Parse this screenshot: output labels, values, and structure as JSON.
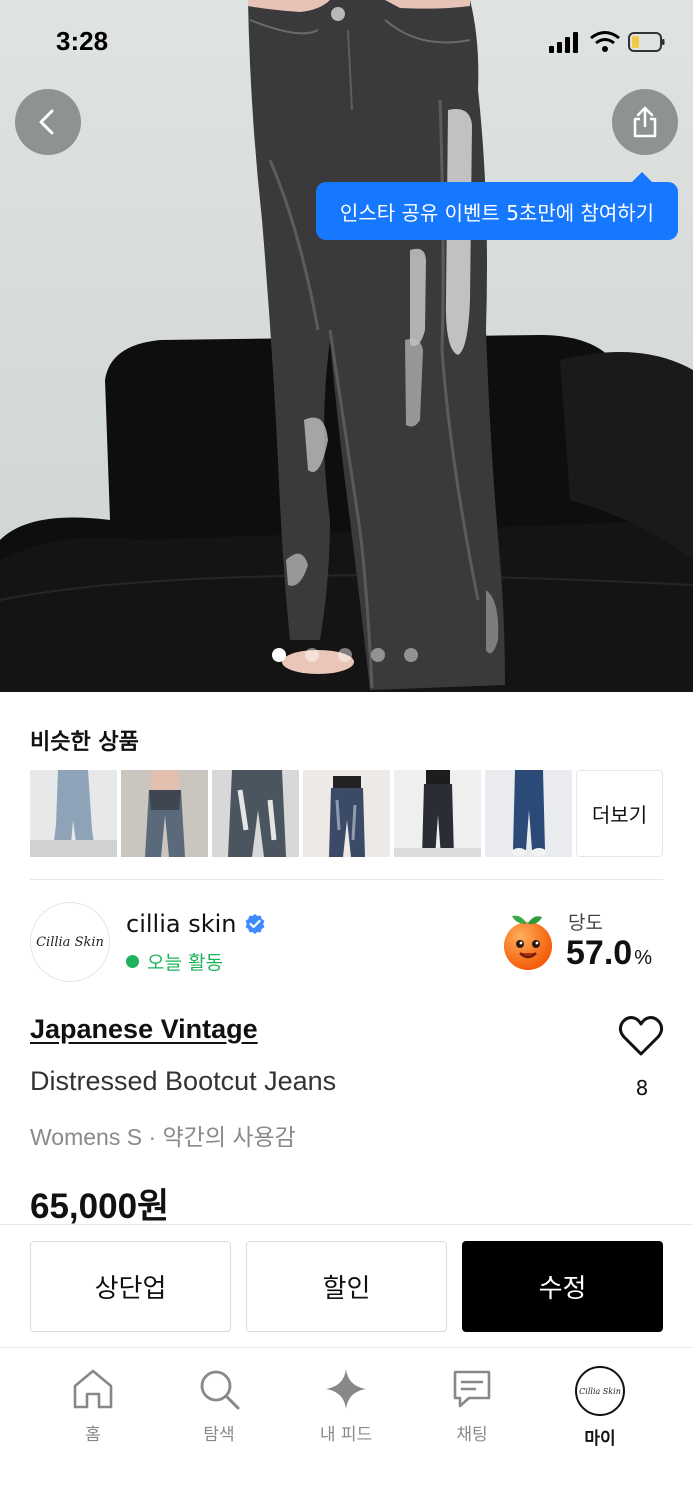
{
  "status_bar": {
    "time": "3:28"
  },
  "hero": {
    "tooltip": "인스타 공유 이벤트 5초만에 참여하기",
    "image_count": 5,
    "active_index": 0
  },
  "similar": {
    "title": "비슷한 상품",
    "thumbnails": [
      "thumb-1",
      "thumb-2",
      "thumb-3",
      "thumb-4",
      "thumb-5",
      "thumb-6"
    ],
    "more_label": "더보기"
  },
  "seller": {
    "avatar_text": "Cillia Skin",
    "name": "cillia skin",
    "status": "오늘 활동",
    "sweetness_label": "당도",
    "sweetness_value": "57.0",
    "sweetness_unit": "%"
  },
  "product": {
    "brand": "Japanese Vintage",
    "name": "Distressed Bootcut Jeans",
    "meta": "Womens S · 약간의 사용감",
    "price": "65,000원",
    "like_count": "8"
  },
  "actions": {
    "bump": "상단업",
    "discount": "할인",
    "edit": "수정"
  },
  "tabs": [
    {
      "label": "홈",
      "icon": "home-icon"
    },
    {
      "label": "탐색",
      "icon": "search-icon"
    },
    {
      "label": "내 피드",
      "icon": "sparkle-icon"
    },
    {
      "label": "채팅",
      "icon": "chat-icon"
    },
    {
      "label": "마이",
      "icon": "avatar"
    }
  ],
  "colors": {
    "accent_blue": "#1677ff",
    "online_green": "#1db35b",
    "primary_black": "#000000"
  }
}
